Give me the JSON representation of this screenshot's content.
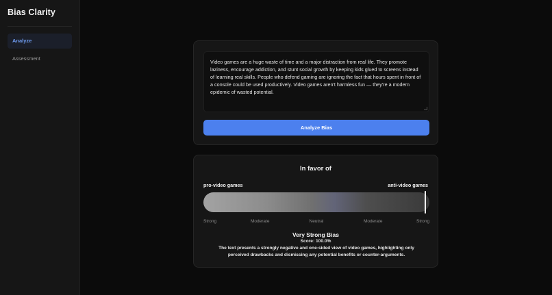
{
  "app": {
    "title": "Bias Clarity"
  },
  "sidebar": {
    "items": [
      {
        "label": "Analyze",
        "active": true
      },
      {
        "label": "Assessment",
        "active": false
      }
    ]
  },
  "input": {
    "text": "Video games are a huge waste of time and a major distraction from real life. They promote laziness, encourage addiction, and stunt social growth by keeping kids glued to screens instead of learning real skills. People who defend gaming are ignoring the fact that hours spent in front of a console could be used productively. Video games aren't harmless fun — they're a modern epidemic of wasted potential.",
    "button_label": "Analyze Bias"
  },
  "result": {
    "title": "In favor of",
    "left_label": "pro-video games",
    "right_label": "anti-video games",
    "scale_labels": [
      "Strong",
      "Moderate",
      "Neutral",
      "Moderate",
      "Strong"
    ],
    "marker_fraction": 1.0,
    "verdict": "Very Strong Bias",
    "score_text": "Score: 100.0%",
    "explanation": "The text presents a strongly negative and one-sided view of video games, highlighting only perceived drawbacks and dismissing any potential benefits or counter-arguments."
  },
  "colors": {
    "accent": "#4c80ee",
    "background": "#0b0b0b",
    "card": "#161616",
    "sidebar": "#161616"
  }
}
